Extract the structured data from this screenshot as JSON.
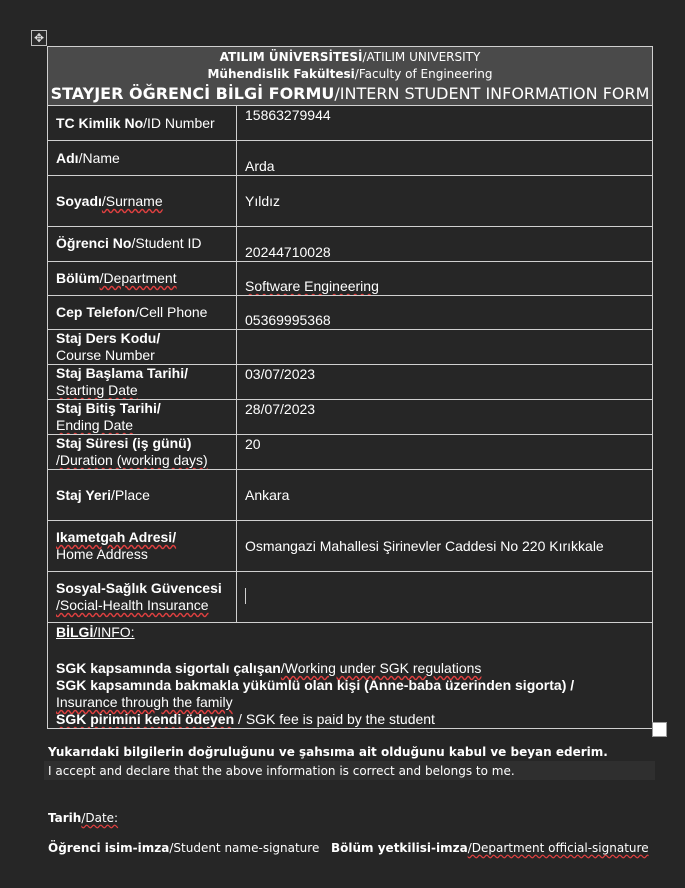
{
  "header": {
    "line1_tr": "ATILIM ÜNİVERSİTESİ",
    "line1_en": "/ATILIM UNIVERSITY",
    "line2_tr": "Mühendislik Fakültesi",
    "line2_en": "/Faculty of Engineering",
    "line3_tr": "STAYJER ÖĞRENCİ BİLGİ FORMU",
    "line3_en": "/INTERN STUDENT INFORMATION FORM"
  },
  "rows": [
    {
      "label_tr": "TC Kimlik No",
      "label_en": "/ID Number",
      "value": "15863279944"
    },
    {
      "label_tr": "Adı",
      "label_en": "/Name",
      "value": "Arda"
    },
    {
      "label_tr": "Soyadı",
      "label_en": "/Surname",
      "value": "Yıldız"
    },
    {
      "label_tr": "Öğrenci No",
      "label_en": "/Student ID",
      "value": "20244710028"
    },
    {
      "label_tr": "Bölüm",
      "label_en": "/Department",
      "value": "Software Engineering"
    },
    {
      "label_tr": "Cep Telefon",
      "label_en": "/Cell Phone",
      "value": "05369995368"
    },
    {
      "label_tr": "Staj Ders Kodu/",
      "label_en": "Course Number",
      "value": ""
    },
    {
      "label_tr": "Staj Başlama Tarihi/",
      "label_en": "Starting Date",
      "value": "03/07/2023"
    },
    {
      "label_tr": "Staj Bitiş Tarihi/",
      "label_en": "Ending Date",
      "value": "28/07/2023"
    },
    {
      "label_tr": "Staj Süresi (iş günü)",
      "label_en": "/Duration (working days)",
      "value": "20"
    },
    {
      "label_tr": "Staj Yeri",
      "label_en": "/Place",
      "value": "Ankara"
    },
    {
      "label_tr": "Ikametgah Adresi/",
      "label_en": "Home Address",
      "value": "Osmangazi Mahallesi Şirinevler Caddesi No 220 Kırıkkale"
    },
    {
      "label_tr": "Sosyal-Sağlık Güvencesi",
      "label_en": "/Social-Health Insurance",
      "value": ""
    }
  ],
  "info": {
    "title_tr": "BİLGİ",
    "title_en": "/INFO:",
    "opt1_tr": "SGK kapsamında sigortalı çalışan",
    "opt1_en": "/Working under SGK regulations",
    "opt2_tr": "SGK kapsamında bakmakla yükümlü olan kişi (Anne-baba üzerinden sigorta) /",
    "opt2_en": "Insurance through the family",
    "opt3_tr": "SGK pirimini kendi ödeyen",
    "opt3_en": " / SGK fee is paid by the student"
  },
  "declaration": {
    "tr": "Yukarıdaki bilgilerin doğruluğunu ve şahsıma ait olduğunu kabul ve beyan ederim.",
    "en": "I accept and declare that the above information is correct and belongs to me."
  },
  "signatures": {
    "date_tr": "Tarih",
    "date_en": "/Date:",
    "student_tr": "Öğrenci isim-imza",
    "student_en": "/Student name-signature",
    "dept_tr": "Bölüm yetkilisi-imza",
    "dept_en": "/Department official-signature"
  }
}
